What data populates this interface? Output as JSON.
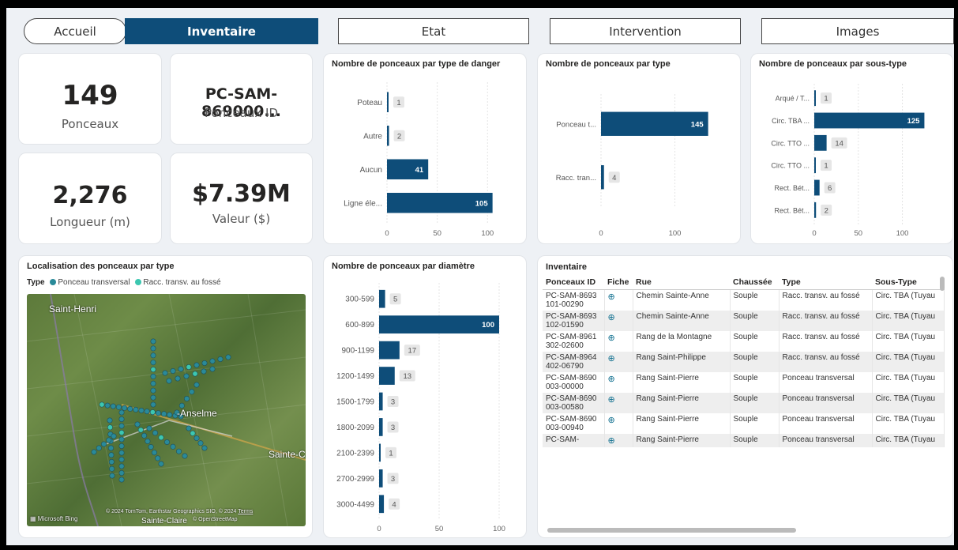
{
  "nav": {
    "accueil": "Accueil",
    "inventaire": "Inventaire",
    "etat": "Etat",
    "intervention": "Intervention",
    "images": "Images"
  },
  "kpis": {
    "ponceaux_value": "149",
    "ponceaux_label": "Ponceaux",
    "id_value": "PC-SAM-869000...",
    "id_label": "Ponceaux ID",
    "longueur_value": "2,276",
    "longueur_label": "Longueur (m)",
    "valeur_value": "$7.39M",
    "valeur_label": "Valeur ($)"
  },
  "colors": {
    "bar": "#0e4d79",
    "transversal": "#2a8a99",
    "fosse": "#3cc7b0",
    "nav_active": "#0e4d79"
  },
  "chart_data": [
    {
      "type": "bar",
      "title": "Nombre de ponceaux par type de danger",
      "categories": [
        "Poteau",
        "Autre",
        "Aucun",
        "Ligne éle..."
      ],
      "values": [
        1,
        2,
        41,
        105
      ],
      "xticks": [
        "0",
        "50",
        "100"
      ],
      "xlim": [
        0,
        110
      ]
    },
    {
      "type": "bar",
      "title": "Nombre de ponceaux par type",
      "categories": [
        "Ponceau t...",
        "Racc. tran..."
      ],
      "values": [
        145,
        4
      ],
      "xticks": [
        "0",
        "100"
      ],
      "xlim": [
        0,
        155
      ]
    },
    {
      "type": "bar",
      "title": "Nombre de ponceaux par sous-type",
      "categories": [
        "Arqué / T...",
        "Circ. TBA ...",
        "Circ. TTO ...",
        "Circ. TTO ...",
        "Rect. Bét...",
        "Rect. Bét..."
      ],
      "values": [
        1,
        125,
        14,
        1,
        6,
        2
      ],
      "xticks": [
        "0",
        "50",
        "100"
      ],
      "xlim": [
        0,
        130
      ]
    },
    {
      "type": "bar",
      "title": "Nombre de ponceaux par diamètre",
      "categories": [
        "300-599",
        "600-899",
        "900-1199",
        "1200-1499",
        "1500-1799",
        "1800-2099",
        "2100-2399",
        "2700-2999",
        "3000-4499"
      ],
      "values": [
        5,
        100,
        17,
        13,
        3,
        3,
        1,
        3,
        4
      ],
      "xticks": [
        "0",
        "50",
        "100"
      ],
      "xlim": [
        0,
        100
      ]
    }
  ],
  "map": {
    "title": "Localisation des ponceaux par type",
    "legend_title": "Type",
    "legend_items": [
      "Ponceau transversal",
      "Racc. transv. au fossé"
    ],
    "places": [
      "Saint-Henri",
      "-Anselme",
      "Sainte-C",
      "Sainte-Claire"
    ],
    "attribution": "© 2024 TomTom, Earthstar Geographics SIO, © 2024",
    "terms": "Terms",
    "osm": "© OpenStreetMap",
    "bing": "Microsoft Bing"
  },
  "table": {
    "title": "Inventaire",
    "headers": [
      "Ponceaux ID",
      "Fiche",
      "Rue",
      "Chaussée",
      "Type",
      "Sous-Type"
    ],
    "rows": [
      [
        "PC-SAM-8693101-00290",
        "Chemin Sainte-Anne",
        "Souple",
        "Racc. transv. au fossé",
        "Circ. TBA (Tuyau"
      ],
      [
        "PC-SAM-8693102-01590",
        "Chemin Sainte-Anne",
        "Souple",
        "Racc. transv. au fossé",
        "Circ. TBA (Tuyau"
      ],
      [
        "PC-SAM-8961302-02600",
        "Rang de la Montagne",
        "Souple",
        "Racc. transv. au fossé",
        "Circ. TBA (Tuyau"
      ],
      [
        "PC-SAM-8964402-06790",
        "Rang Saint-Philippe",
        "Souple",
        "Racc. transv. au fossé",
        "Circ. TBA (Tuyau"
      ],
      [
        "PC-SAM-8690003-00000",
        "Rang Saint-Pierre",
        "Souple",
        "Ponceau transversal",
        "Circ. TBA (Tuyau"
      ],
      [
        "PC-SAM-8690003-00580",
        "Rang Saint-Pierre",
        "Souple",
        "Ponceau transversal",
        "Circ. TBA (Tuyau"
      ],
      [
        "PC-SAM-8690003-00940",
        "Rang Saint-Pierre",
        "Souple",
        "Ponceau transversal",
        "Circ. TBA (Tuyau"
      ],
      [
        "PC-SAM-",
        "Rang Saint-Pierre",
        "Souple",
        "Ponceau transversal",
        "Circ. TBA (Tuyau"
      ]
    ]
  }
}
